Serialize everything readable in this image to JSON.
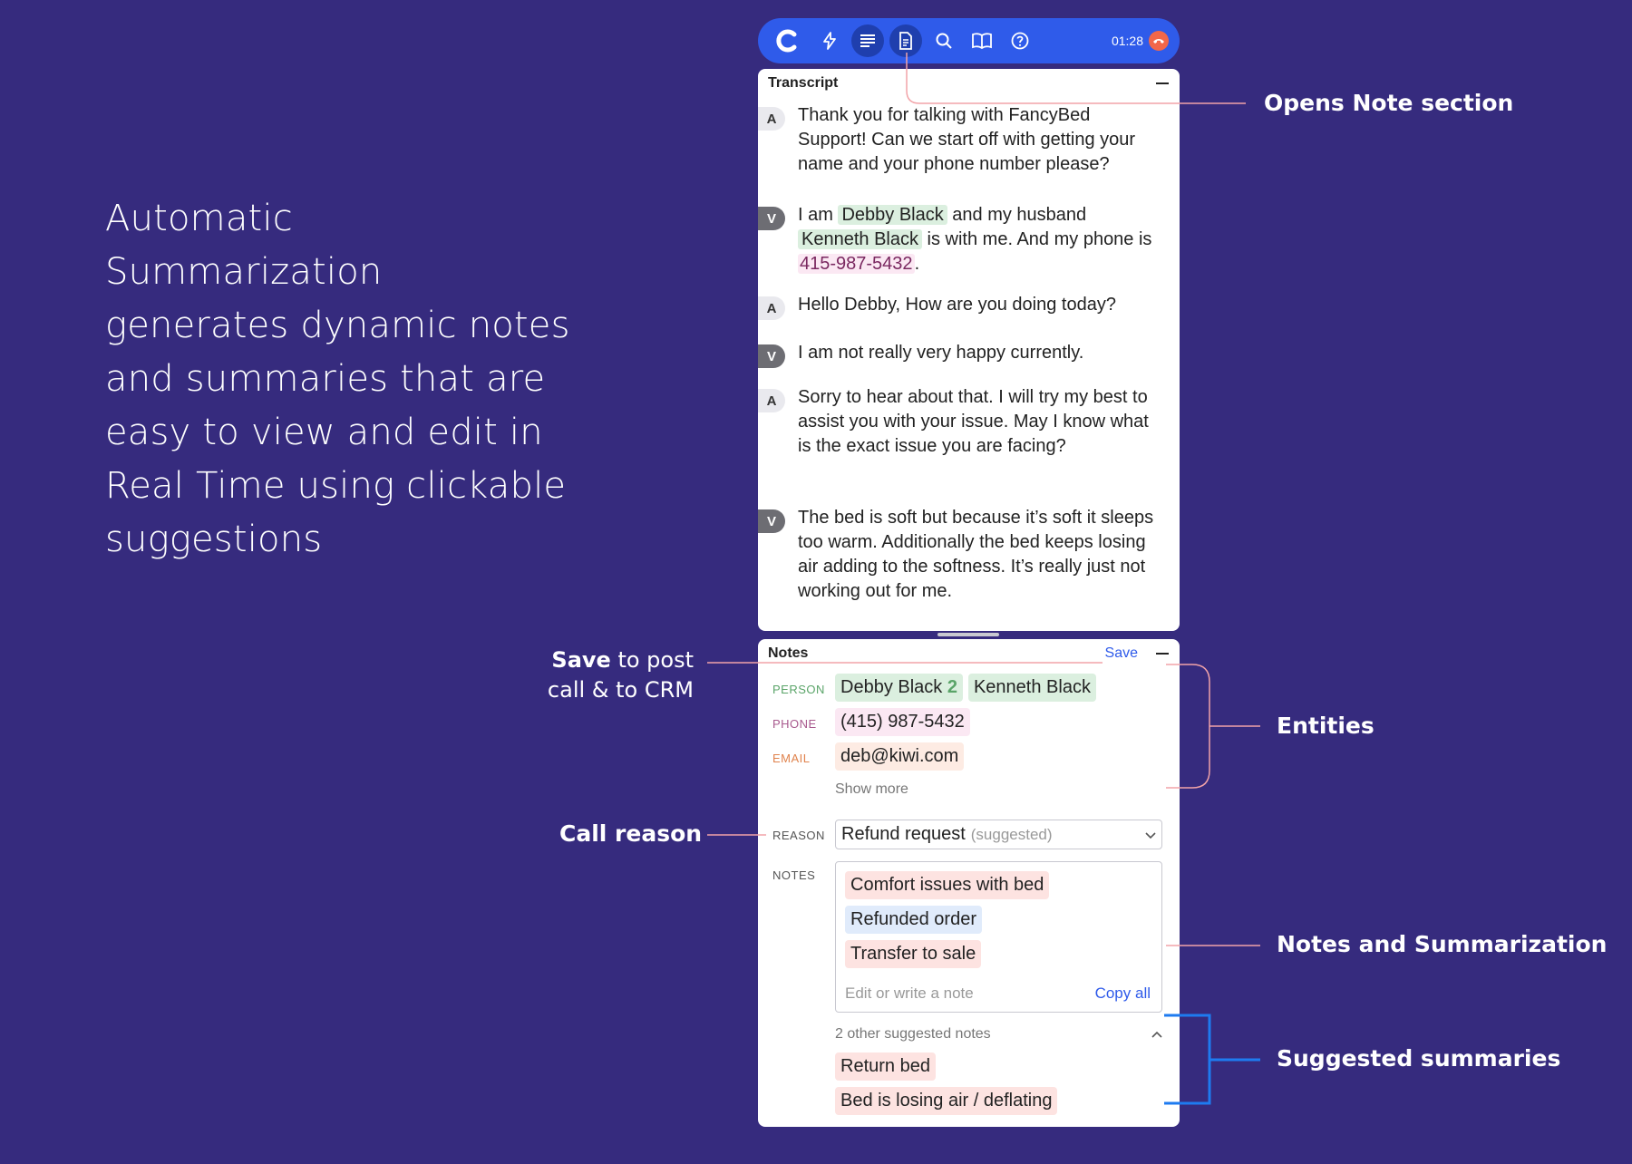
{
  "headline": "Automatic Summarization generates dynamic notes and summaries that are easy to view and edit in Real Time using clickable suggestions",
  "toolbar": {
    "time": "01:28",
    "icons": [
      "logo-icon",
      "lightning-icon",
      "transcript-icon",
      "note-icon",
      "search-icon",
      "book-icon",
      "help-icon",
      "hangup-icon"
    ]
  },
  "transcript": {
    "title": "Transcript",
    "messages": [
      {
        "speaker": "A",
        "text": "Thank you for talking with FancyBed Support! Can we start off with getting your name and your phone number please?"
      },
      {
        "speaker": "V",
        "pre": "I am ",
        "e1": "Debby Black",
        "mid": " and my husband ",
        "e2": "Kenneth Black",
        "mid2": " is with me. And my phone is ",
        "e3": "415-987-5432",
        "post": "."
      },
      {
        "speaker": "A",
        "text": "Hello Debby, How are you doing today?"
      },
      {
        "speaker": "V",
        "text": "I am not really very happy currently."
      },
      {
        "speaker": "A",
        "text": "Sorry to hear about that. I will try my best to assist you with your issue. May I know what is the exact issue you are facing?"
      },
      {
        "speaker": "V",
        "text": "The bed is soft but because it’s soft it sleeps too warm. Additionally the bed keeps losing air adding to the softness. It’s really just not working out for me."
      }
    ]
  },
  "notes": {
    "title": "Notes",
    "save_label": "Save",
    "person_label": "PERSON",
    "person1": "Debby Black",
    "person1_count": "2",
    "person2": "Kenneth Black",
    "phone_label": "PHONE",
    "phone": "(415) 987-5432",
    "email_label": "EMAIL",
    "email": "deb@kiwi.com",
    "show_more": "Show more",
    "reason_label": "REASON",
    "reason_value": "Refund request",
    "reason_suggested": "(suggested)",
    "notes_label": "NOTES",
    "note_items": [
      "Comfort issues with bed",
      "Refunded order",
      "Transfer to sale"
    ],
    "note_placeholder": "Edit or write a note",
    "copy_all": "Copy all",
    "other_suggested": "2 other suggested notes",
    "suggested_items": [
      "Return bed",
      "Bed is losing air / deflating"
    ]
  },
  "annotations": {
    "opens_note": "Opens Note section",
    "save_bold": "Save",
    "save_rest1": " to post",
    "save_rest2": "call & to CRM",
    "entities": "Entities",
    "call_reason": "Call reason",
    "notes_summarization": "Notes and Summarization",
    "suggested_summaries": "Suggested summaries"
  },
  "colors": {
    "background": "#362b7e",
    "toolbar": "#2f5bea",
    "annotation_line": "#f2a3a8",
    "suggested_bracket": "#1e7bf0"
  }
}
